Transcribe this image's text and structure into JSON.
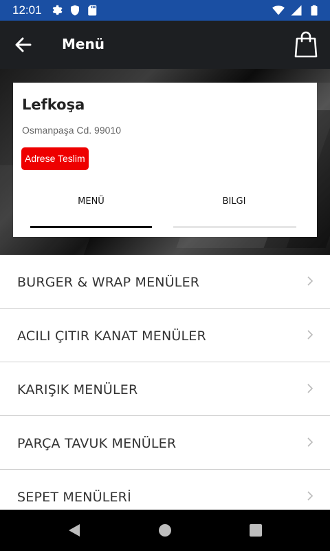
{
  "status_bar": {
    "time": "12:01",
    "left_icons": [
      "gear-icon",
      "shield-icon",
      "sd-card-icon"
    ],
    "right_icons": [
      "wifi-icon",
      "signal-icon",
      "battery-icon"
    ],
    "background": "#1a4fa3"
  },
  "app_bar": {
    "title": "Menü",
    "back_icon": "arrow-left-icon",
    "cart_icon": "shopping-bag-icon",
    "background": "#1d1f22"
  },
  "restaurant": {
    "name": "Lefkoşa",
    "address": "Osmanpaşa Cd. 99010",
    "badge": "Adrese Teslim",
    "badge_color": "#ee0000"
  },
  "tabs": [
    {
      "label": "MENÜ",
      "active": true
    },
    {
      "label": "BILGI",
      "active": false
    }
  ],
  "menu_categories": [
    {
      "label": "BURGER & WRAP MENÜLER"
    },
    {
      "label": "ACILI ÇITIR KANAT MENÜLER"
    },
    {
      "label": "KARIŞIK MENÜLER"
    },
    {
      "label": "PARÇA TAVUK MENÜLER"
    },
    {
      "label": "SEPET MENÜLERİ"
    }
  ],
  "nav_bar": {
    "buttons": [
      "back-triangle-icon",
      "home-circle-icon",
      "recents-square-icon"
    ]
  }
}
